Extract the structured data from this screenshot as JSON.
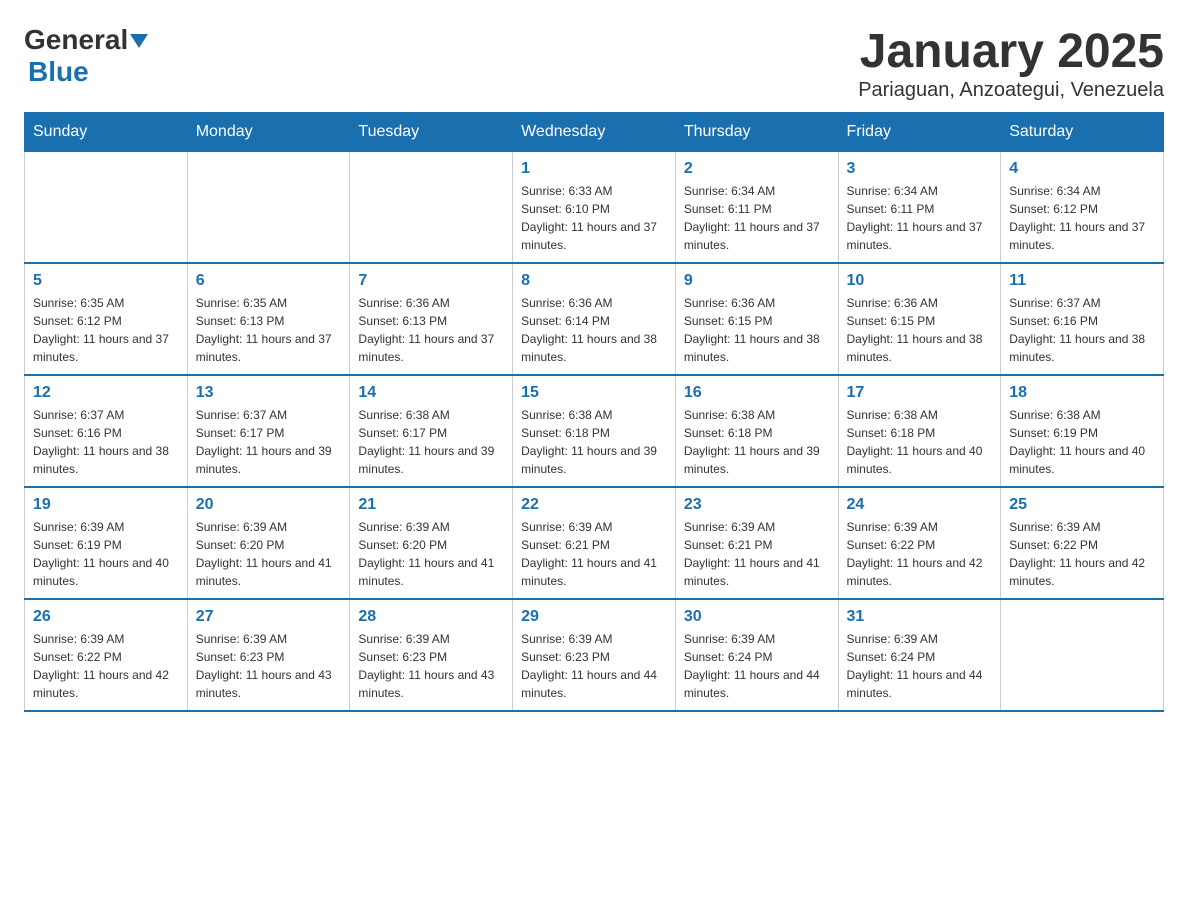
{
  "header": {
    "logo_general": "General",
    "logo_blue": "Blue",
    "title": "January 2025",
    "subtitle": "Pariaguan, Anzoategui, Venezuela"
  },
  "calendar": {
    "days_of_week": [
      "Sunday",
      "Monday",
      "Tuesday",
      "Wednesday",
      "Thursday",
      "Friday",
      "Saturday"
    ],
    "weeks": [
      [
        {
          "day": "",
          "info": ""
        },
        {
          "day": "",
          "info": ""
        },
        {
          "day": "",
          "info": ""
        },
        {
          "day": "1",
          "info": "Sunrise: 6:33 AM\nSunset: 6:10 PM\nDaylight: 11 hours and 37 minutes."
        },
        {
          "day": "2",
          "info": "Sunrise: 6:34 AM\nSunset: 6:11 PM\nDaylight: 11 hours and 37 minutes."
        },
        {
          "day": "3",
          "info": "Sunrise: 6:34 AM\nSunset: 6:11 PM\nDaylight: 11 hours and 37 minutes."
        },
        {
          "day": "4",
          "info": "Sunrise: 6:34 AM\nSunset: 6:12 PM\nDaylight: 11 hours and 37 minutes."
        }
      ],
      [
        {
          "day": "5",
          "info": "Sunrise: 6:35 AM\nSunset: 6:12 PM\nDaylight: 11 hours and 37 minutes."
        },
        {
          "day": "6",
          "info": "Sunrise: 6:35 AM\nSunset: 6:13 PM\nDaylight: 11 hours and 37 minutes."
        },
        {
          "day": "7",
          "info": "Sunrise: 6:36 AM\nSunset: 6:13 PM\nDaylight: 11 hours and 37 minutes."
        },
        {
          "day": "8",
          "info": "Sunrise: 6:36 AM\nSunset: 6:14 PM\nDaylight: 11 hours and 38 minutes."
        },
        {
          "day": "9",
          "info": "Sunrise: 6:36 AM\nSunset: 6:15 PM\nDaylight: 11 hours and 38 minutes."
        },
        {
          "day": "10",
          "info": "Sunrise: 6:36 AM\nSunset: 6:15 PM\nDaylight: 11 hours and 38 minutes."
        },
        {
          "day": "11",
          "info": "Sunrise: 6:37 AM\nSunset: 6:16 PM\nDaylight: 11 hours and 38 minutes."
        }
      ],
      [
        {
          "day": "12",
          "info": "Sunrise: 6:37 AM\nSunset: 6:16 PM\nDaylight: 11 hours and 38 minutes."
        },
        {
          "day": "13",
          "info": "Sunrise: 6:37 AM\nSunset: 6:17 PM\nDaylight: 11 hours and 39 minutes."
        },
        {
          "day": "14",
          "info": "Sunrise: 6:38 AM\nSunset: 6:17 PM\nDaylight: 11 hours and 39 minutes."
        },
        {
          "day": "15",
          "info": "Sunrise: 6:38 AM\nSunset: 6:18 PM\nDaylight: 11 hours and 39 minutes."
        },
        {
          "day": "16",
          "info": "Sunrise: 6:38 AM\nSunset: 6:18 PM\nDaylight: 11 hours and 39 minutes."
        },
        {
          "day": "17",
          "info": "Sunrise: 6:38 AM\nSunset: 6:18 PM\nDaylight: 11 hours and 40 minutes."
        },
        {
          "day": "18",
          "info": "Sunrise: 6:38 AM\nSunset: 6:19 PM\nDaylight: 11 hours and 40 minutes."
        }
      ],
      [
        {
          "day": "19",
          "info": "Sunrise: 6:39 AM\nSunset: 6:19 PM\nDaylight: 11 hours and 40 minutes."
        },
        {
          "day": "20",
          "info": "Sunrise: 6:39 AM\nSunset: 6:20 PM\nDaylight: 11 hours and 41 minutes."
        },
        {
          "day": "21",
          "info": "Sunrise: 6:39 AM\nSunset: 6:20 PM\nDaylight: 11 hours and 41 minutes."
        },
        {
          "day": "22",
          "info": "Sunrise: 6:39 AM\nSunset: 6:21 PM\nDaylight: 11 hours and 41 minutes."
        },
        {
          "day": "23",
          "info": "Sunrise: 6:39 AM\nSunset: 6:21 PM\nDaylight: 11 hours and 41 minutes."
        },
        {
          "day": "24",
          "info": "Sunrise: 6:39 AM\nSunset: 6:22 PM\nDaylight: 11 hours and 42 minutes."
        },
        {
          "day": "25",
          "info": "Sunrise: 6:39 AM\nSunset: 6:22 PM\nDaylight: 11 hours and 42 minutes."
        }
      ],
      [
        {
          "day": "26",
          "info": "Sunrise: 6:39 AM\nSunset: 6:22 PM\nDaylight: 11 hours and 42 minutes."
        },
        {
          "day": "27",
          "info": "Sunrise: 6:39 AM\nSunset: 6:23 PM\nDaylight: 11 hours and 43 minutes."
        },
        {
          "day": "28",
          "info": "Sunrise: 6:39 AM\nSunset: 6:23 PM\nDaylight: 11 hours and 43 minutes."
        },
        {
          "day": "29",
          "info": "Sunrise: 6:39 AM\nSunset: 6:23 PM\nDaylight: 11 hours and 44 minutes."
        },
        {
          "day": "30",
          "info": "Sunrise: 6:39 AM\nSunset: 6:24 PM\nDaylight: 11 hours and 44 minutes."
        },
        {
          "day": "31",
          "info": "Sunrise: 6:39 AM\nSunset: 6:24 PM\nDaylight: 11 hours and 44 minutes."
        },
        {
          "day": "",
          "info": ""
        }
      ]
    ]
  }
}
